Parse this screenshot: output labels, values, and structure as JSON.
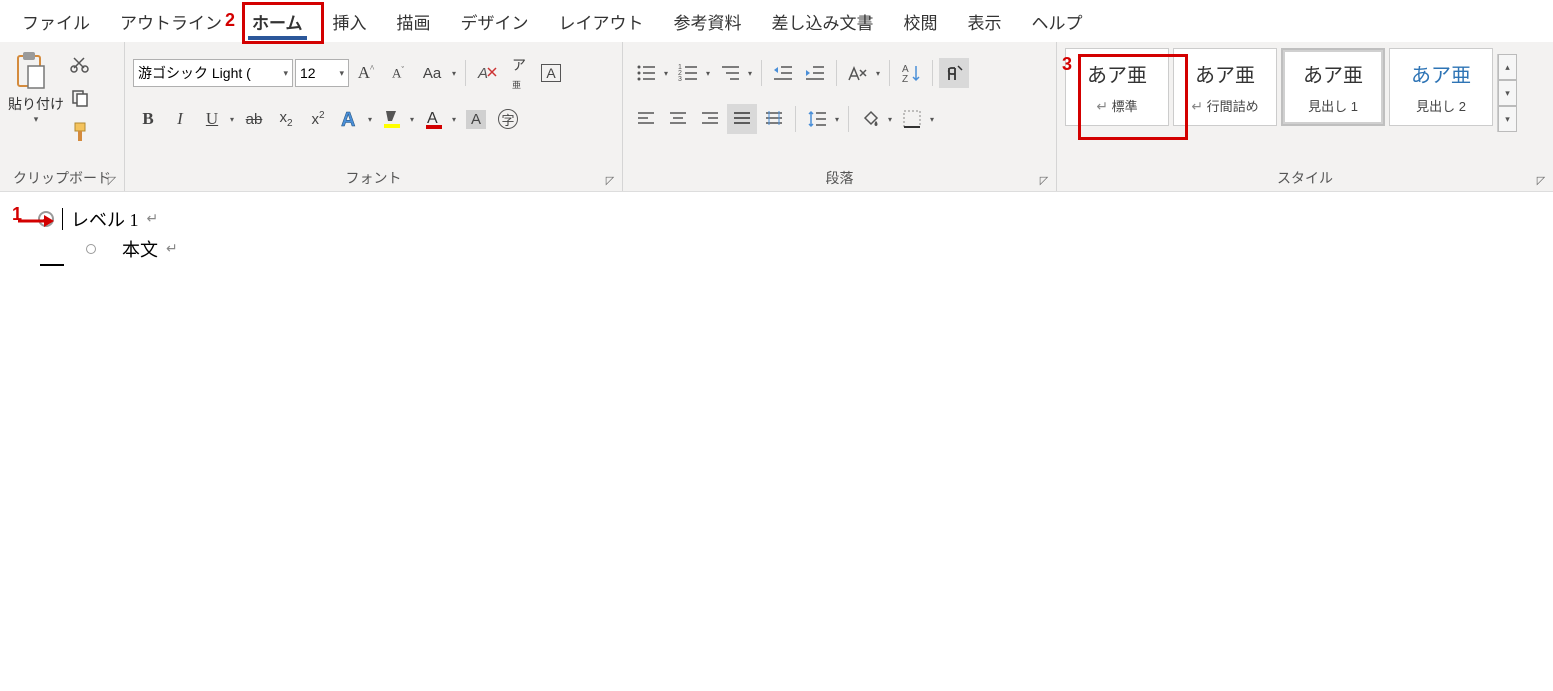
{
  "tabs": {
    "file": "ファイル",
    "outline": "アウトライン",
    "home": "ホーム",
    "insert": "挿入",
    "draw": "描画",
    "design": "デザイン",
    "layout": "レイアウト",
    "reference": "参考資料",
    "mailings": "差し込み文書",
    "review": "校閲",
    "view": "表示",
    "help": "ヘルプ"
  },
  "clipboard": {
    "paste": "貼り付け",
    "group": "クリップボード"
  },
  "font": {
    "name": "游ゴシック Light (",
    "size": "12",
    "group": "フォント"
  },
  "para": {
    "group": "段落"
  },
  "styles": {
    "group": "スタイル",
    "preview": "あア亜",
    "items": {
      "normal": "標準",
      "nospacing": "行間詰め",
      "h1": "見出し 1",
      "h2": "見出し 2"
    },
    "pilcrow": "↵"
  },
  "doc": {
    "line1": "レベル 1",
    "line2": "本文",
    "ret": "↵"
  },
  "anno": {
    "n1": "1",
    "n2": "2",
    "n3": "3"
  }
}
